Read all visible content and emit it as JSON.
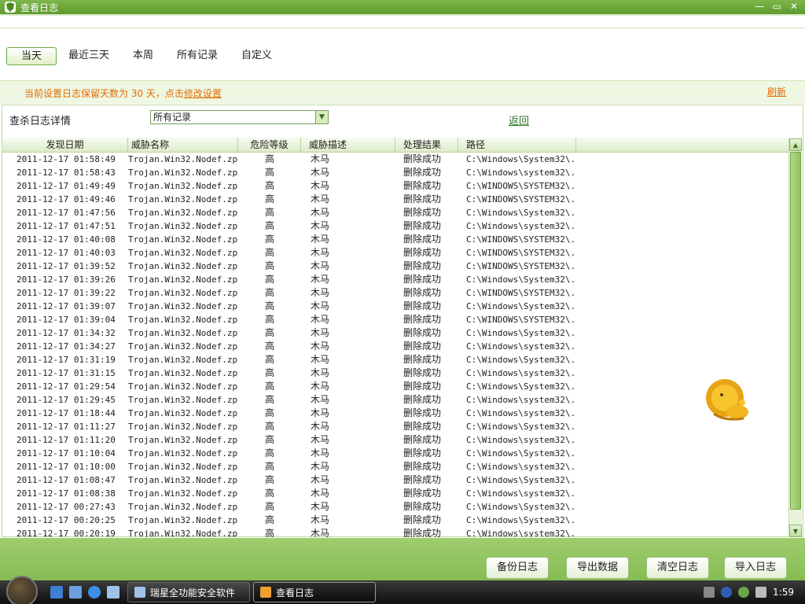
{
  "window": {
    "title": "查看日志",
    "controls": [
      "—",
      "▭",
      "✕"
    ]
  },
  "tabs": [
    {
      "label": "当天",
      "active": true
    },
    {
      "label": "最近三天",
      "active": false
    },
    {
      "label": "本周",
      "active": false
    },
    {
      "label": "所有记录",
      "active": false
    },
    {
      "label": "自定义",
      "active": false
    }
  ],
  "info": {
    "message_prefix": "当前设置日志保留天数为 30 天，点击",
    "settings_link": "修改设置",
    "refresh_link": "刷新"
  },
  "filter": {
    "label": "查杀日志详情",
    "selected": "所有记录",
    "back_link": "返回"
  },
  "table": {
    "headers": [
      "发现日期",
      "威胁名称",
      "危险等级",
      "威胁描述",
      "处理结果",
      "路径"
    ],
    "rows": [
      [
        "2011-12-17 01:58:49",
        "Trojan.Win32.Nodef.zpq",
        "高",
        "木马",
        "删除成功",
        "C:\\Windows\\System32\\..."
      ],
      [
        "2011-12-17 01:58:43",
        "Trojan.Win32.Nodef.zpq",
        "高",
        "木马",
        "删除成功",
        "C:\\Windows\\system32\\..."
      ],
      [
        "2011-12-17 01:49:49",
        "Trojan.Win32.Nodef.zpq",
        "高",
        "木马",
        "删除成功",
        "C:\\WINDOWS\\SYSTEM32\\..."
      ],
      [
        "2011-12-17 01:49:46",
        "Trojan.Win32.Nodef.zpq",
        "高",
        "木马",
        "删除成功",
        "C:\\WINDOWS\\SYSTEM32\\..."
      ],
      [
        "2011-12-17 01:47:56",
        "Trojan.Win32.Nodef.zpq",
        "高",
        "木马",
        "删除成功",
        "C:\\Windows\\System32\\..."
      ],
      [
        "2011-12-17 01:47:51",
        "Trojan.Win32.Nodef.zpq",
        "高",
        "木马",
        "删除成功",
        "C:\\Windows\\system32\\..."
      ],
      [
        "2011-12-17 01:40:08",
        "Trojan.Win32.Nodef.zpq",
        "高",
        "木马",
        "删除成功",
        "C:\\WINDOWS\\SYSTEM32\\..."
      ],
      [
        "2011-12-17 01:40:03",
        "Trojan.Win32.Nodef.zpq",
        "高",
        "木马",
        "删除成功",
        "C:\\WINDOWS\\SYSTEM32\\..."
      ],
      [
        "2011-12-17 01:39:52",
        "Trojan.Win32.Nodef.zpq",
        "高",
        "木马",
        "删除成功",
        "C:\\WINDOWS\\SYSTEM32\\..."
      ],
      [
        "2011-12-17 01:39:26",
        "Trojan.Win32.Nodef.zpq",
        "高",
        "木马",
        "删除成功",
        "C:\\Windows\\System32\\..."
      ],
      [
        "2011-12-17 01:39:22",
        "Trojan.Win32.Nodef.zpq",
        "高",
        "木马",
        "删除成功",
        "C:\\WINDOWS\\SYSTEM32\\..."
      ],
      [
        "2011-12-17 01:39:07",
        "Trojan.Win32.Nodef.zpq",
        "高",
        "木马",
        "删除成功",
        "C:\\Windows\\System32\\..."
      ],
      [
        "2011-12-17 01:39:04",
        "Trojan.Win32.Nodef.zpq",
        "高",
        "木马",
        "删除成功",
        "C:\\WINDOWS\\SYSTEM32\\..."
      ],
      [
        "2011-12-17 01:34:32",
        "Trojan.Win32.Nodef.zpq",
        "高",
        "木马",
        "删除成功",
        "C:\\Windows\\System32\\..."
      ],
      [
        "2011-12-17 01:34:27",
        "Trojan.Win32.Nodef.zpq",
        "高",
        "木马",
        "删除成功",
        "C:\\Windows\\system32\\..."
      ],
      [
        "2011-12-17 01:31:19",
        "Trojan.Win32.Nodef.zpq",
        "高",
        "木马",
        "删除成功",
        "C:\\Windows\\System32\\..."
      ],
      [
        "2011-12-17 01:31:15",
        "Trojan.Win32.Nodef.zpq",
        "高",
        "木马",
        "删除成功",
        "C:\\Windows\\system32\\..."
      ],
      [
        "2011-12-17 01:29:54",
        "Trojan.Win32.Nodef.zpq",
        "高",
        "木马",
        "删除成功",
        "C:\\Windows\\System32\\..."
      ],
      [
        "2011-12-17 01:29:45",
        "Trojan.Win32.Nodef.zpq",
        "高",
        "木马",
        "删除成功",
        "C:\\Windows\\system32\\..."
      ],
      [
        "2011-12-17 01:18:44",
        "Trojan.Win32.Nodef.zpq",
        "高",
        "木马",
        "删除成功",
        "C:\\Windows\\system32\\..."
      ],
      [
        "2011-12-17 01:11:27",
        "Trojan.Win32.Nodef.zpq",
        "高",
        "木马",
        "删除成功",
        "C:\\Windows\\System32\\..."
      ],
      [
        "2011-12-17 01:11:20",
        "Trojan.Win32.Nodef.zpq",
        "高",
        "木马",
        "删除成功",
        "C:\\Windows\\system32\\..."
      ],
      [
        "2011-12-17 01:10:04",
        "Trojan.Win32.Nodef.zpq",
        "高",
        "木马",
        "删除成功",
        "C:\\Windows\\System32\\..."
      ],
      [
        "2011-12-17 01:10:00",
        "Trojan.Win32.Nodef.zpq",
        "高",
        "木马",
        "删除成功",
        "C:\\Windows\\system32\\..."
      ],
      [
        "2011-12-17 01:08:47",
        "Trojan.Win32.Nodef.zpq",
        "高",
        "木马",
        "删除成功",
        "C:\\Windows\\System32\\..."
      ],
      [
        "2011-12-17 01:08:38",
        "Trojan.Win32.Nodef.zpq",
        "高",
        "木马",
        "删除成功",
        "C:\\Windows\\system32\\..."
      ],
      [
        "2011-12-17 00:27:43",
        "Trojan.Win32.Nodef.zpq",
        "高",
        "木马",
        "删除成功",
        "C:\\Windows\\System32\\..."
      ],
      [
        "2011-12-17 00:20:25",
        "Trojan.Win32.Nodef.zpq",
        "高",
        "木马",
        "删除成功",
        "C:\\Windows\\System32\\..."
      ],
      [
        "2011-12-17 00:20:19",
        "Trojan.Win32.Nodef.zpq",
        "高",
        "木马",
        "删除成功",
        "C:\\Windows\\system32\\..."
      ]
    ]
  },
  "buttons": {
    "backup": "备份日志",
    "export": "导出数据",
    "clear": "清空日志",
    "import": "导入日志"
  },
  "taskbar": {
    "tasks": [
      {
        "label": "瑞星全功能安全软件",
        "active": false
      },
      {
        "label": "查看日志",
        "active": true
      }
    ],
    "clock": "1:59"
  },
  "colors": {
    "accent": "#86bc53",
    "link_orange": "#e36b00"
  }
}
